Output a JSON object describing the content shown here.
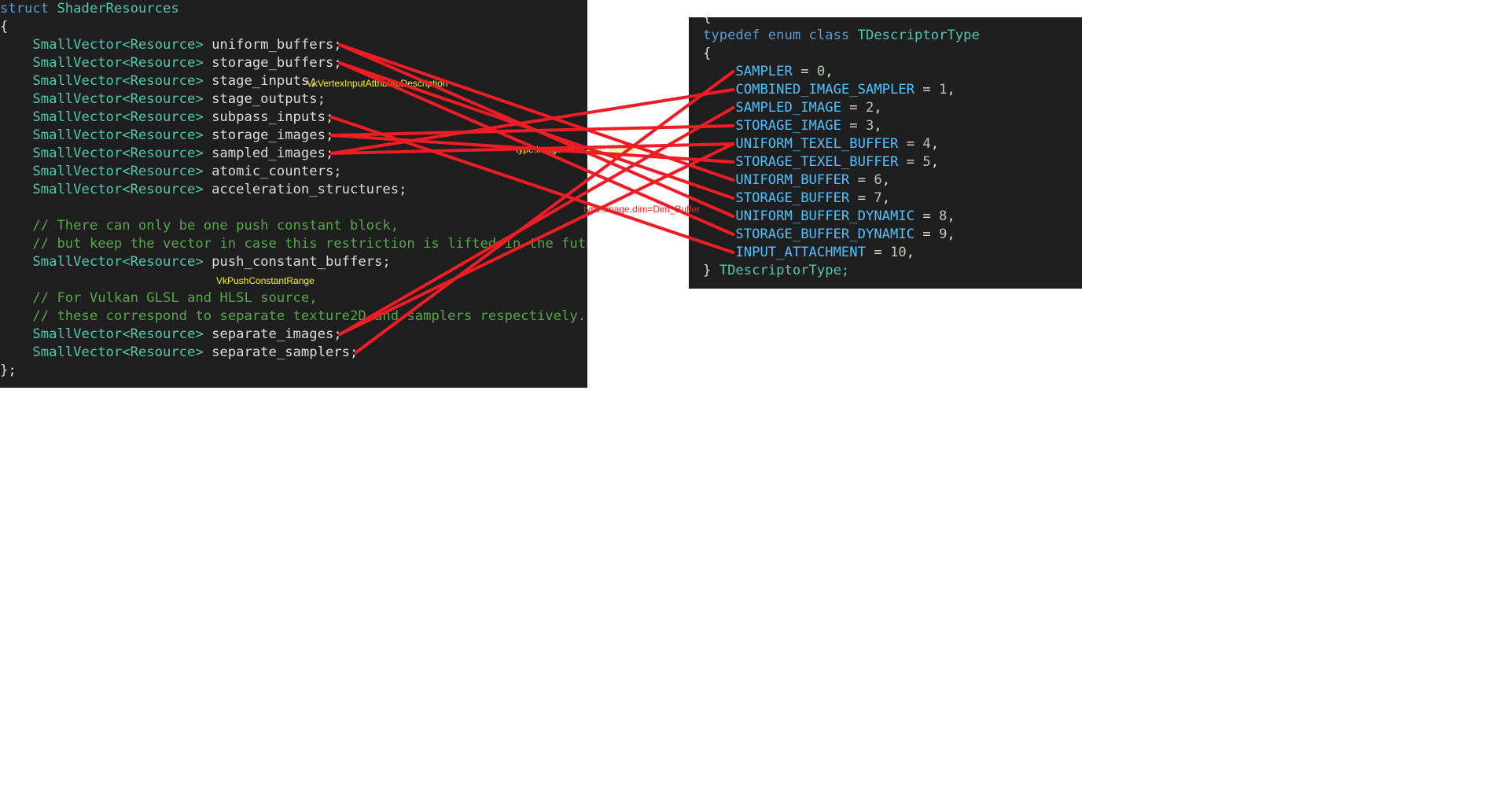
{
  "left_code": {
    "struct_keyword": "struct",
    "struct_name": "ShaderResources",
    "open_brace": "{",
    "close_brace": "};",
    "type_prefix": "SmallVector<Resource>",
    "fields": [
      {
        "name": "uniform_buffers"
      },
      {
        "name": "storage_buffers"
      },
      {
        "name": "stage_inputs"
      },
      {
        "name": "stage_outputs"
      },
      {
        "name": "subpass_inputs"
      },
      {
        "name": "storage_images"
      },
      {
        "name": "sampled_images"
      },
      {
        "name": "atomic_counters"
      },
      {
        "name": "acceleration_structures"
      }
    ],
    "comment_1": "// There can only be one push constant block,",
    "comment_2": "// but keep the vector in case this restriction is lifted in the future.",
    "push_constant_field": "push_constant_buffers",
    "comment_3": "// For Vulkan GLSL and HLSL source,",
    "comment_4": "// these correspond to separate texture2D and samplers respectively.",
    "separate_fields": [
      {
        "name": "separate_images"
      },
      {
        "name": "separate_samplers"
      }
    ]
  },
  "right_code": {
    "partial_top_line": "{",
    "typedef_keywords": "typedef enum class",
    "enum_name": "TDescriptorType",
    "open_brace": "{",
    "enumerators": [
      {
        "name": "SAMPLER",
        "value": "0"
      },
      {
        "name": "COMBINED_IMAGE_SAMPLER",
        "value": "1"
      },
      {
        "name": "SAMPLED_IMAGE",
        "value": "2"
      },
      {
        "name": "STORAGE_IMAGE",
        "value": "3"
      },
      {
        "name": "UNIFORM_TEXEL_BUFFER",
        "value": "4"
      },
      {
        "name": "STORAGE_TEXEL_BUFFER",
        "value": "5"
      },
      {
        "name": "UNIFORM_BUFFER",
        "value": "6"
      },
      {
        "name": "STORAGE_BUFFER",
        "value": "7"
      },
      {
        "name": "UNIFORM_BUFFER_DYNAMIC",
        "value": "8"
      },
      {
        "name": "STORAGE_BUFFER_DYNAMIC",
        "value": "9"
      },
      {
        "name": "INPUT_ATTACHMENT",
        "value": "10"
      }
    ],
    "closing_brace": "}",
    "closing_name": "TDescriptorType;"
  },
  "annotations": {
    "vertex_input": "VkVertexInputAttributeDescription",
    "push_constant": "VkPushConstantRange",
    "sampled_image_dim": "type.image.dim!=Dim_Buffer",
    "storage_image_dim": "type.image.dim=Dim_Buffer"
  },
  "colors": {
    "editor_background": "#1e1e1e",
    "keyword": "#569cd6",
    "type": "#4ec9b0",
    "comment": "#57a64a",
    "enumerator": "#4fc1ff",
    "number": "#b5cea8",
    "connector_line": "#ee1c24",
    "annotation_yellow": "#f6f600",
    "annotation_red": "#ff2020"
  },
  "connections": [
    {
      "from": "uniform_buffers",
      "to": "UNIFORM_BUFFER"
    },
    {
      "from": "uniform_buffers",
      "to": "UNIFORM_BUFFER_DYNAMIC"
    },
    {
      "from": "storage_buffers",
      "to": "STORAGE_BUFFER"
    },
    {
      "from": "storage_buffers",
      "to": "STORAGE_BUFFER_DYNAMIC"
    },
    {
      "from": "subpass_inputs",
      "to": "INPUT_ATTACHMENT"
    },
    {
      "from": "storage_images",
      "to": "STORAGE_IMAGE"
    },
    {
      "from": "storage_images",
      "to": "STORAGE_TEXEL_BUFFER"
    },
    {
      "from": "sampled_images",
      "to": "COMBINED_IMAGE_SAMPLER"
    },
    {
      "from": "sampled_images",
      "to": "UNIFORM_TEXEL_BUFFER"
    },
    {
      "from": "separate_images",
      "to": "SAMPLED_IMAGE"
    },
    {
      "from": "separate_images",
      "to": "UNIFORM_TEXEL_BUFFER"
    },
    {
      "from": "separate_samplers",
      "to": "SAMPLER"
    }
  ]
}
